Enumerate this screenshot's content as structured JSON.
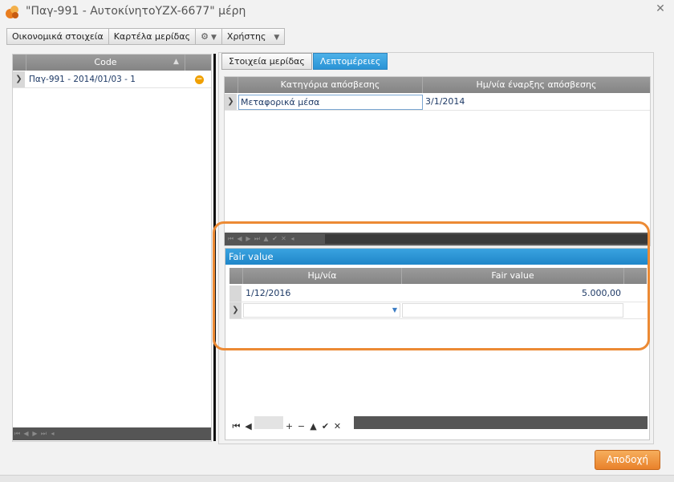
{
  "window": {
    "title": "\"Παγ-991 - ΑυτοκίνητοYZX-6677\" μέρη",
    "close_icon": "close-icon"
  },
  "toolbar": {
    "financial_label": "Οικονομικά στοιχεία",
    "share_card_label": "Καρτέλα μερίδας",
    "settings_icon": "gear-icon",
    "user_label": "Χρήστης"
  },
  "left_grid": {
    "column_header": "Code",
    "rows": [
      {
        "text": "Παγ-991 - 2014/01/03 - 1",
        "status_icon": "minus-circle-icon",
        "status_color": "#f0a000"
      }
    ]
  },
  "tabs": [
    {
      "label": "Στοιχεία μερίδας",
      "active": false
    },
    {
      "label": "Λεπτομέρειες",
      "active": true
    }
  ],
  "depreciation_grid": {
    "headers": [
      "Κατηγόρια απόσβεσης",
      "Ημ/νία έναρξης απόσβεσης"
    ],
    "rows": [
      {
        "category": "Μεταφορικά μέσα",
        "start_date": "3/1/2014"
      }
    ]
  },
  "fair_value": {
    "group_title": "Fair value",
    "headers": [
      "Ημ/νία",
      "Fair value"
    ],
    "rows": [
      {
        "date": "1/12/2016",
        "value": "5.000,00"
      }
    ],
    "new_row": {
      "date": "",
      "value": ""
    }
  },
  "colors": {
    "accent": "#2993d6",
    "highlight": "#ec8a34",
    "accept": "#e9812b"
  },
  "footer": {
    "accept_label": "Αποδοχή"
  }
}
